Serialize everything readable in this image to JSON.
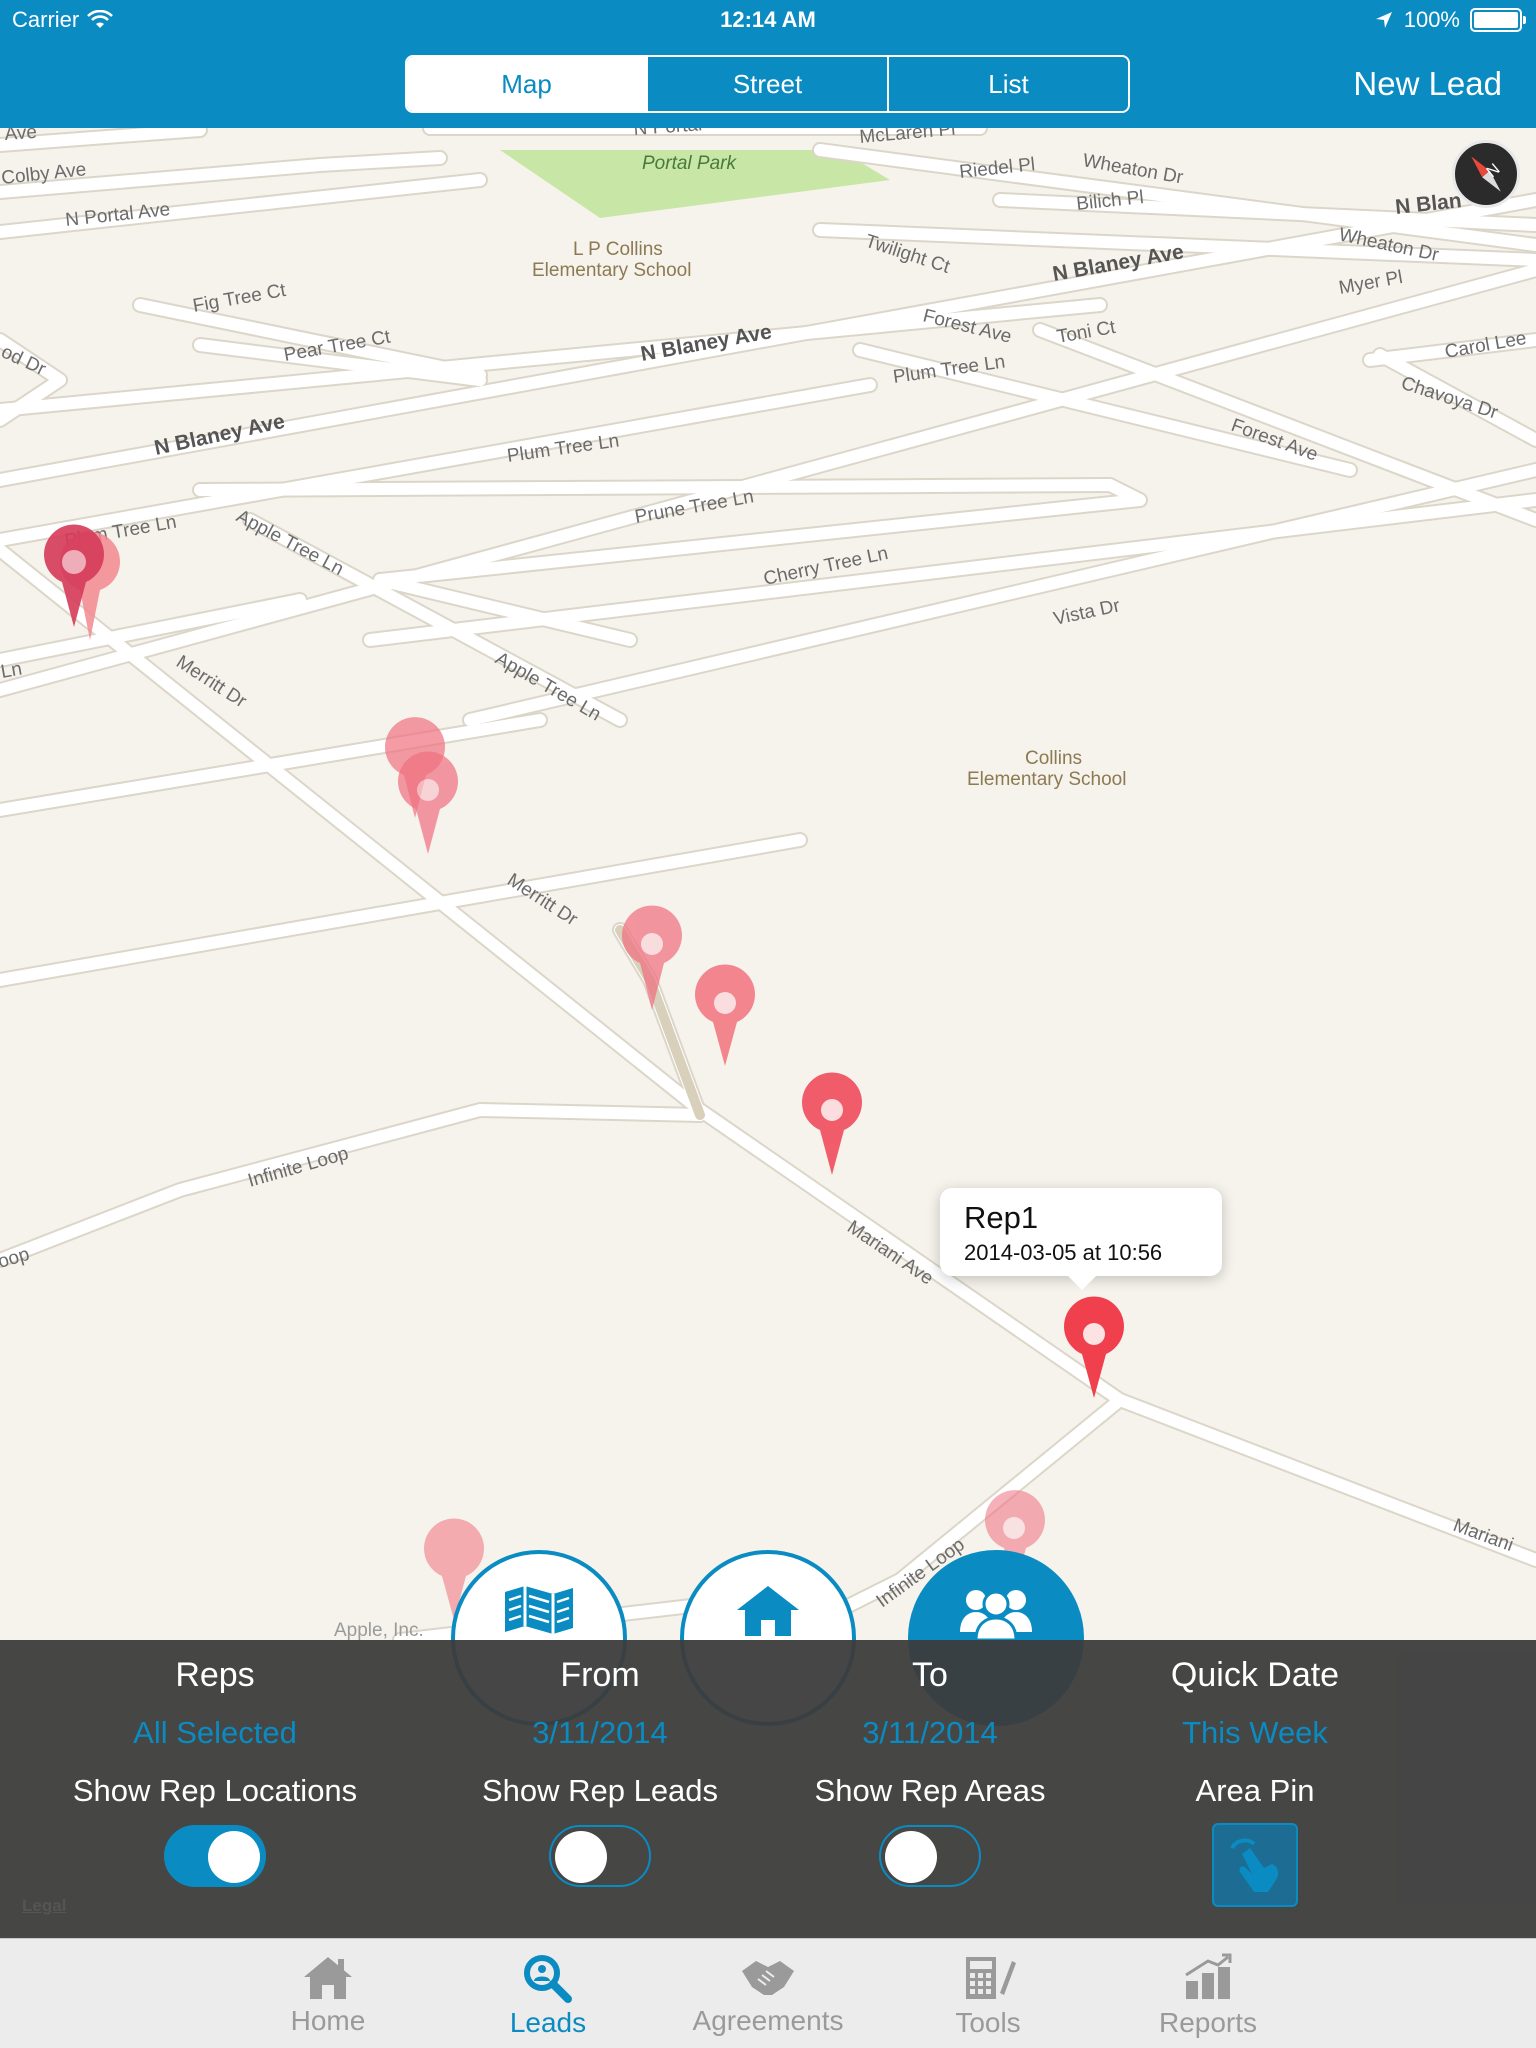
{
  "status_bar": {
    "carrier": "Carrier",
    "time": "12:14 AM",
    "battery": "100%"
  },
  "segmented_control": {
    "options": [
      "Map",
      "Street",
      "List"
    ],
    "selected": "Map"
  },
  "new_lead_label": "New Lead",
  "map": {
    "streets": {
      "ave_top": "Ave",
      "colby_ave": "Colby Ave",
      "n_portal_ave": "N Portal Ave",
      "n_portal": "N Portal",
      "mclaren": "McLaren Pl",
      "riedel_pl": "Riedel Pl",
      "wheaton_dr_1": "Wheaton Dr",
      "bilich_pl": "Bilich Pl",
      "n_blaney_right": "N Blan",
      "twilight_ct": "Twilight Ct",
      "n_blaney_ave_1": "N Blaney Ave",
      "wheaton_dr_2": "Wheaton Dr",
      "myer_pl": "Myer Pl",
      "fig_tree_ct": "Fig Tree Ct",
      "pear_tree_ct": "Pear Tree Ct",
      "n_blaney_ave_2": "N Blaney Ave",
      "forest_ave_1": "Forest Ave",
      "toni_ct": "Toni Ct",
      "carol_lee": "Carol Lee",
      "od_dr": "od Dr",
      "plum_tree_ln_1": "Plum Tree Ln",
      "chavoya_dr": "Chavoya Dr",
      "n_blaney_ave_3": "N Blaney Ave",
      "plum_tree_ln_2": "Plum Tree Ln",
      "forest_ave_2": "Forest Ave",
      "prune_tree_ln": "Prune Tree Ln",
      "plum_tree_ln_3": "Plum Tree Ln",
      "apple_tree_ln_1": "Apple Tree Ln",
      "cherry_tree_ln": "Cherry Tree Ln",
      "vista_dr": "Vista Dr",
      "ln_left": "Ln",
      "merritt_dr_1": "Merritt Dr",
      "apple_tree_ln_2": "Apple Tree Ln",
      "merritt_dr_2": "Merritt Dr",
      "infinite_loop_1": "Infinite Loop",
      "oop_left": "oop",
      "mariani_ave_1": "Mariani Ave",
      "mariani_ave_2": "Mariani",
      "infinite_loop_2": "Infinite Loop"
    },
    "places": {
      "portal_park": "Portal Park",
      "lp_collins_1": "L P Collins",
      "lp_collins_2": "Elementary School",
      "collins_1": "Collins",
      "collins_2": "Elementary School"
    },
    "callout": {
      "title": "Rep1",
      "subtitle": "2014-03-05 at 10:56"
    },
    "attribution": "Apple, Inc.",
    "legal": "Legal",
    "pin_color": "#f0404e",
    "compass_icon": "compass-icon"
  },
  "floating_buttons": [
    {
      "name": "map-view-button",
      "icon": "map-icon"
    },
    {
      "name": "home-view-button",
      "icon": "house-icon"
    },
    {
      "name": "reps-view-button",
      "icon": "people-icon"
    }
  ],
  "filter_panel": {
    "reps": {
      "title": "Reps",
      "value": "All Selected"
    },
    "from": {
      "title": "From",
      "value": "3/11/2014"
    },
    "to": {
      "title": "To",
      "value": "3/11/2014"
    },
    "quick_date": {
      "title": "Quick Date",
      "value": "This Week"
    },
    "show_rep_locations": {
      "label": "Show Rep Locations",
      "on": true
    },
    "show_rep_leads": {
      "label": "Show Rep Leads",
      "on": false
    },
    "show_rep_areas": {
      "label": "Show Rep Areas",
      "on": false
    },
    "area_pin": {
      "label": "Area Pin",
      "icon": "hand-pointer-icon"
    }
  },
  "tab_bar": {
    "tabs": [
      {
        "label": "Home",
        "icon": "house-icon"
      },
      {
        "label": "Leads",
        "icon": "magnifier-icon"
      },
      {
        "label": "Agreements",
        "icon": "handshake-icon"
      },
      {
        "label": "Tools",
        "icon": "calculator-icon"
      },
      {
        "label": "Reports",
        "icon": "bar-chart-icon"
      }
    ],
    "selected": "Leads"
  },
  "colors": {
    "accent": "#0a8bc2",
    "panel": "#3c3c3c",
    "map_bg": "#f6f3ec"
  }
}
